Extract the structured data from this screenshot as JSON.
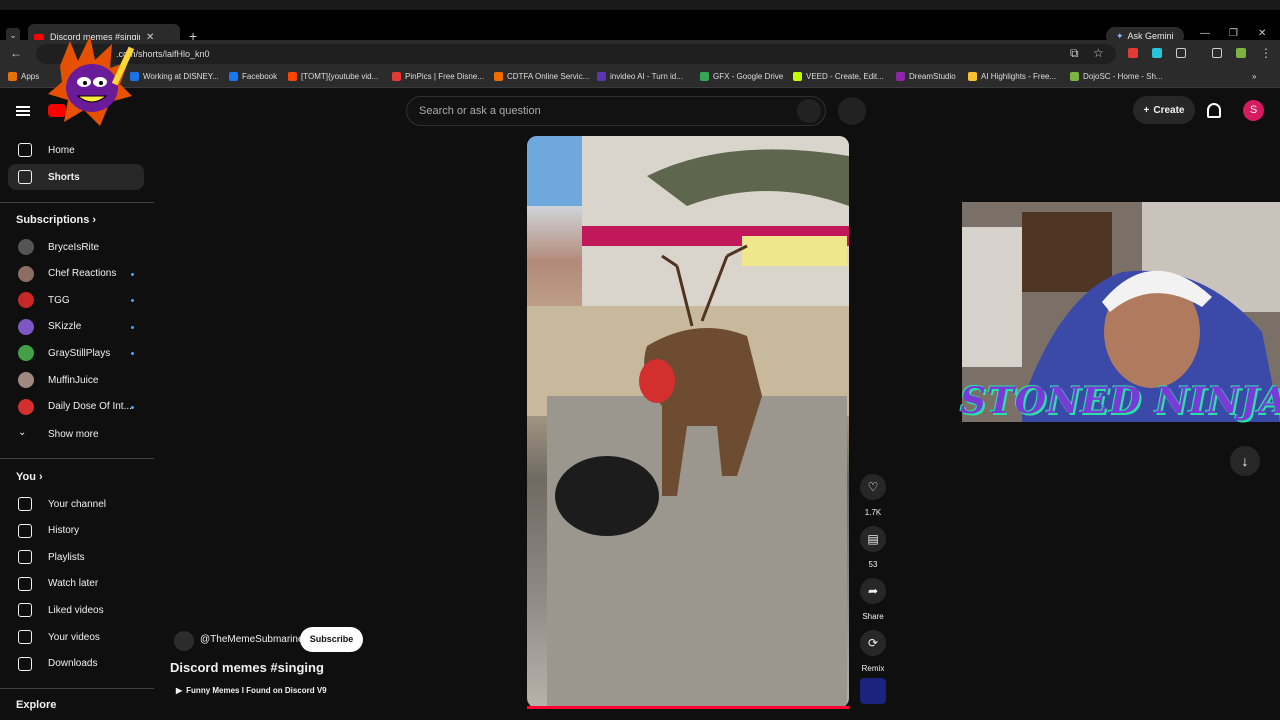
{
  "browser": {
    "tab_title": "Discord memes #singing - ",
    "tab_close": "✕",
    "new_tab": "+",
    "ask_gemini": "Ask Gemini",
    "url": ".com/shorts/laifHlo_kn0",
    "bookmarks": [
      {
        "label": "Apps",
        "color": "#e8710a"
      },
      {
        "label": "Working at DISNEY...",
        "color": "#1a73e8"
      },
      {
        "label": "Facebook",
        "color": "#1877f2"
      },
      {
        "label": "[TOMT]{youtube vid...",
        "color": "#ff4500"
      },
      {
        "label": "PinPics | Free Disne...",
        "color": "#e53935"
      },
      {
        "label": "CDTFA Online Servic...",
        "color": "#ef6c00"
      },
      {
        "label": "invideo AI - Turn id...",
        "color": "#5e35b1"
      },
      {
        "label": "GFX - Google Drive",
        "color": "#34a853"
      },
      {
        "label": "VEED - Create, Edit...",
        "color": "#c6ff00"
      },
      {
        "label": "DreamStudio",
        "color": "#8e24aa"
      },
      {
        "label": "AI Highlights - Free...",
        "color": "#fbc02d"
      },
      {
        "label": "DojoSC - Home - Sh...",
        "color": "#7cb342"
      }
    ]
  },
  "youtube": {
    "search_placeholder": "Search or ask a question",
    "create_label": "Create",
    "avatar_letter": "S",
    "nav": [
      {
        "label": "Home",
        "icon": "home-icon"
      },
      {
        "label": "Shorts",
        "icon": "shorts-icon"
      }
    ],
    "subscriptions_heading": "Subscriptions",
    "subscriptions": [
      {
        "label": "BryceIsRite",
        "color": "#555",
        "dot": false
      },
      {
        "label": "Chef Reactions",
        "color": "#8d6e63",
        "dot": true
      },
      {
        "label": "TGG",
        "color": "#c62828",
        "dot": true
      },
      {
        "label": "SKizzle",
        "color": "#7e57c2",
        "dot": true
      },
      {
        "label": "GrayStillPlays",
        "color": "#43a047",
        "dot": true
      },
      {
        "label": "MuffinJuice",
        "color": "#a1887f",
        "dot": false
      },
      {
        "label": "Daily Dose Of Int...",
        "color": "#d32f2f",
        "dot": true
      }
    ],
    "show_more": "Show more",
    "you_heading": "You",
    "you_items": [
      {
        "label": "Your channel",
        "icon": "channel-icon"
      },
      {
        "label": "History",
        "icon": "history-icon"
      },
      {
        "label": "Playlists",
        "icon": "playlists-icon"
      },
      {
        "label": "Watch later",
        "icon": "watch-later-icon"
      },
      {
        "label": "Liked videos",
        "icon": "like-icon"
      },
      {
        "label": "Your videos",
        "icon": "video-icon"
      },
      {
        "label": "Downloads",
        "icon": "download-icon"
      }
    ],
    "explore_heading": "Explore"
  },
  "short": {
    "channel": "@TheMemeSubmarine",
    "subscribe": "Subscribe",
    "title": "Discord memes #singing",
    "playlist": "Funny Memes I Found on Discord V9",
    "actions": [
      {
        "label": "1.7K",
        "icon": "like-icon"
      },
      {
        "label": "53",
        "icon": "comment-icon"
      },
      {
        "label": "Share",
        "icon": "share-icon"
      },
      {
        "label": "Remix",
        "icon": "remix-icon"
      }
    ]
  },
  "stream_overlay": {
    "text": "STONED NINJA"
  }
}
